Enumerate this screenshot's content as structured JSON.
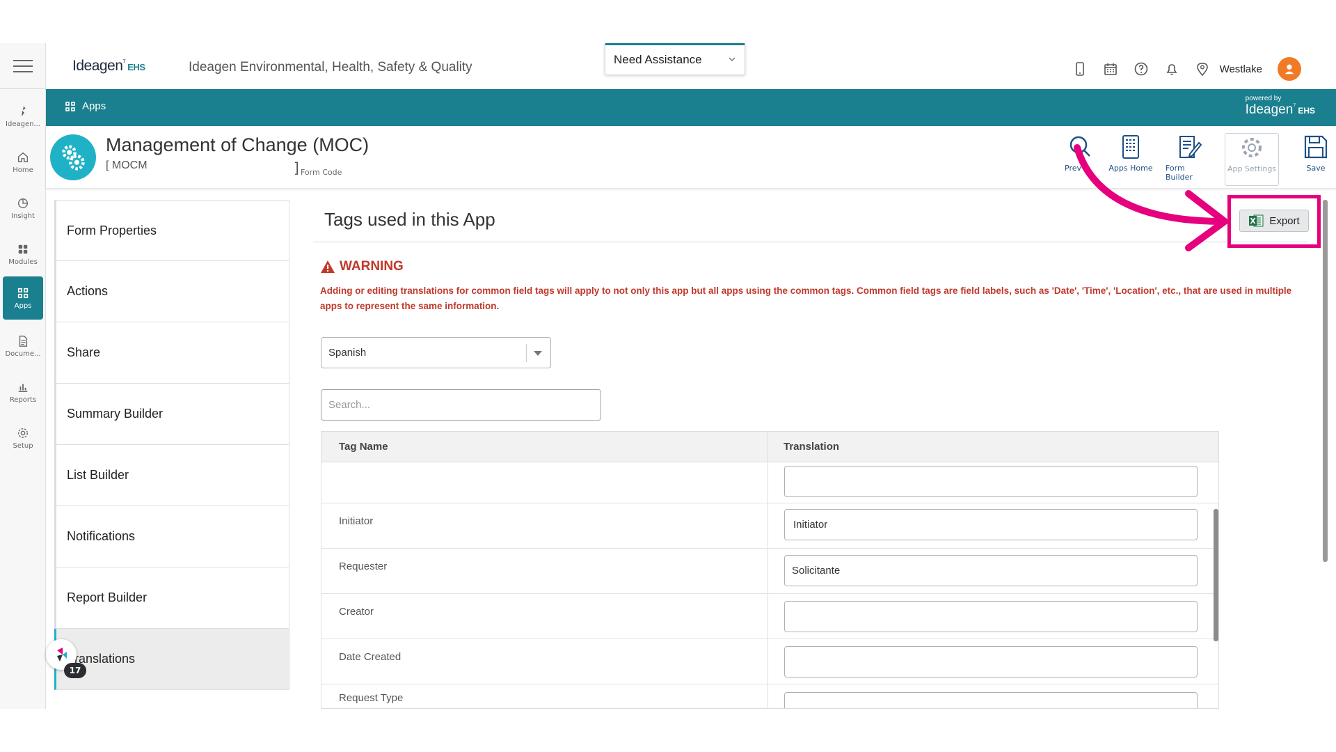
{
  "header": {
    "logo_text": "Ideagen",
    "logo_suffix": "EHS",
    "app_title": "Ideagen Environmental, Health, Safety & Quality",
    "assist_label": "Need Assistance",
    "location": "Westlake"
  },
  "rail": {
    "items": [
      {
        "label": "Ideagen...",
        "icon": "ideagen-icon"
      },
      {
        "label": "Home",
        "icon": "home-icon"
      },
      {
        "label": "Insight",
        "icon": "insight-icon"
      },
      {
        "label": "Modules",
        "icon": "modules-icon"
      },
      {
        "label": "Apps",
        "icon": "apps-icon"
      },
      {
        "label": "Docume...",
        "icon": "document-icon"
      },
      {
        "label": "Reports",
        "icon": "reports-icon"
      },
      {
        "label": "Setup",
        "icon": "setup-icon"
      }
    ],
    "active": "Apps"
  },
  "breadcrumb": {
    "label": "Apps",
    "powered_by": "powered by",
    "powered_logo": "Ideagen",
    "powered_suffix": "EHS"
  },
  "module": {
    "title": "Management of Change (MOC)",
    "code": "[ MOCM",
    "code_end": "]",
    "code_label": "Form Code"
  },
  "toolbar": {
    "preview_label": "Prev",
    "apps_home_label": "Apps Home",
    "form_builder_label": "Form Builder",
    "app_settings_label": "App Settings",
    "save_label": "Save"
  },
  "side_menu": {
    "items": [
      "Form Properties",
      "Actions",
      "Share",
      "Summary Builder",
      "List Builder",
      "Notifications",
      "Report Builder",
      "ranslations"
    ],
    "selected": "ranslations",
    "badge_count": "17"
  },
  "panel": {
    "title": "Tags used in this App",
    "export_label": "Export",
    "warning_title": "WARNING",
    "warning_text": "Adding or editing translations for common field tags will apply to not only this app but all apps using the common tags. Common field tags are field labels, such as 'Date', 'Time', 'Location', etc., that are used in multiple apps to represent the same information.",
    "language": "Spanish",
    "search_placeholder": "Search...",
    "columns": [
      "Tag Name",
      "Translation"
    ],
    "rows": [
      {
        "tag": "",
        "translation": ""
      },
      {
        "tag": "Initiator",
        "translation": "Initiator"
      },
      {
        "tag": "Requester",
        "translation": "Solicitante"
      },
      {
        "tag": "Creator",
        "translation": ""
      },
      {
        "tag": "Date Created",
        "translation": ""
      },
      {
        "tag": "Request Type",
        "translation": ""
      }
    ]
  },
  "colors": {
    "teal": "#1a7f8e",
    "highlight": "#e6007e",
    "warning": "#c0392b"
  }
}
